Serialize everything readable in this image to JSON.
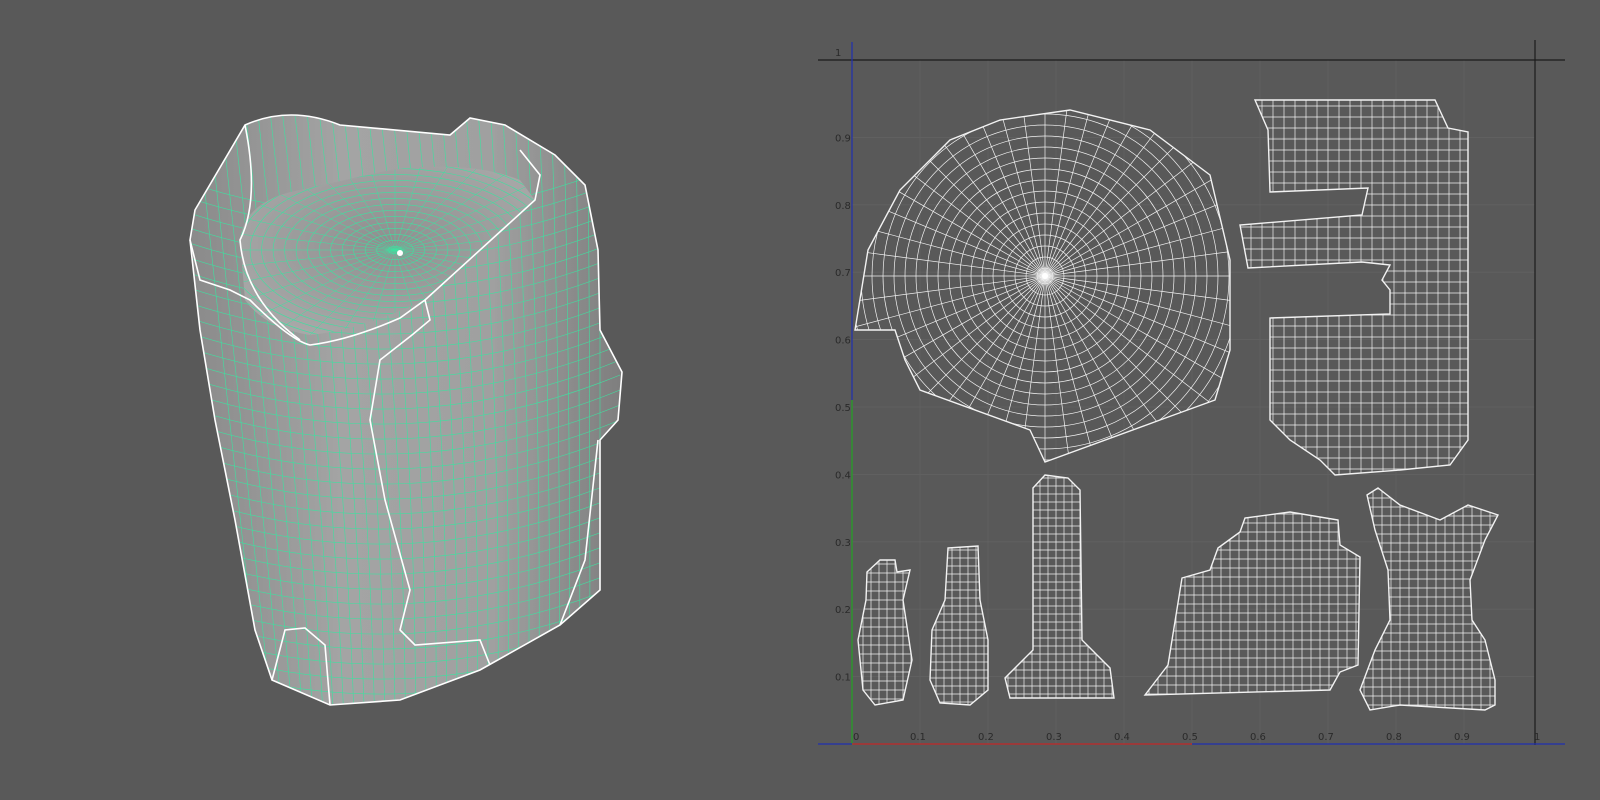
{
  "colors": {
    "background": "#595959",
    "wire_3d": "#3fe0a0",
    "seam": "#ffffff",
    "uv_wire": "#f2f2f2",
    "axis_u": "#b03030",
    "axis_v": "#2a9a2a",
    "axis_blue": "#2030b0",
    "frame": "#1c1c1c"
  },
  "uv_editor": {
    "u_labels": [
      "0",
      "0.1",
      "0.2",
      "0.3",
      "0.4",
      "0.5",
      "0.6",
      "0.7",
      "0.8",
      "0.9",
      "1"
    ],
    "v_labels": [
      "0.1",
      "0.2",
      "0.3",
      "0.4",
      "0.5",
      "0.6",
      "0.7",
      "0.8",
      "0.9",
      "1"
    ]
  }
}
